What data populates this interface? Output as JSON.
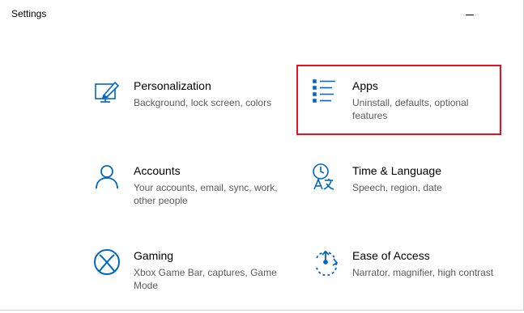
{
  "window": {
    "title": "Settings"
  },
  "tiles": [
    {
      "title": "Personalization",
      "description": "Background, lock screen, colors",
      "icon": "personalization-icon"
    },
    {
      "title": "Apps",
      "description": "Uninstall, defaults, optional features",
      "icon": "apps-icon"
    },
    {
      "title": "Accounts",
      "description": "Your accounts, email, sync, work, other people",
      "icon": "accounts-icon"
    },
    {
      "title": "Time & Language",
      "description": "Speech, region, date",
      "icon": "time-language-icon"
    },
    {
      "title": "Gaming",
      "description": "Xbox Game Bar, captures, Game Mode",
      "icon": "gaming-icon"
    },
    {
      "title": "Ease of Access",
      "description": "Narrator, magnifier, high contrast",
      "icon": "ease-of-access-icon"
    }
  ],
  "colors": {
    "accent": "#0067c0",
    "highlight": "#e81123"
  }
}
